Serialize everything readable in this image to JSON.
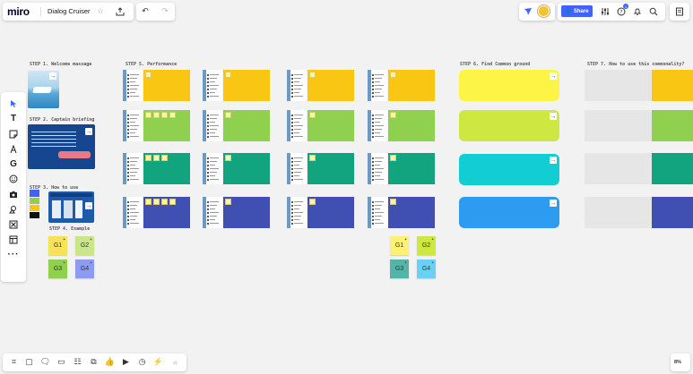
{
  "topbar": {
    "logo": "miro",
    "board_title": "Dialog Cruiser",
    "share_label": "Share",
    "notification_count": "1"
  },
  "steps": {
    "step1": "STEP 1. Welcome massage",
    "step2": "STEP 2. Captain briefing",
    "step3": "STEP 3. How to use",
    "step4": "STEP 4. Example",
    "step5": "STEP 5. Performance",
    "step6": "STEP 6. Find Common ground",
    "step7": "STEP 7. How to use this commonality?"
  },
  "example_notes_left": [
    "G1",
    "G2",
    "G3",
    "G4"
  ],
  "example_notes_right": [
    "G1",
    "G2",
    "G3",
    "G4"
  ],
  "zoom": "8%",
  "colors": {
    "yellow": "#f9c614",
    "green": "#8fd14f",
    "teal": "#12a47f",
    "indigo": "#3f4fb2",
    "step6_yellow": "#fef445",
    "step6_lime": "#cee741",
    "step6_cyan": "#12cdd4",
    "step6_blue": "#2d9bf0",
    "accent": "#4262ff"
  }
}
